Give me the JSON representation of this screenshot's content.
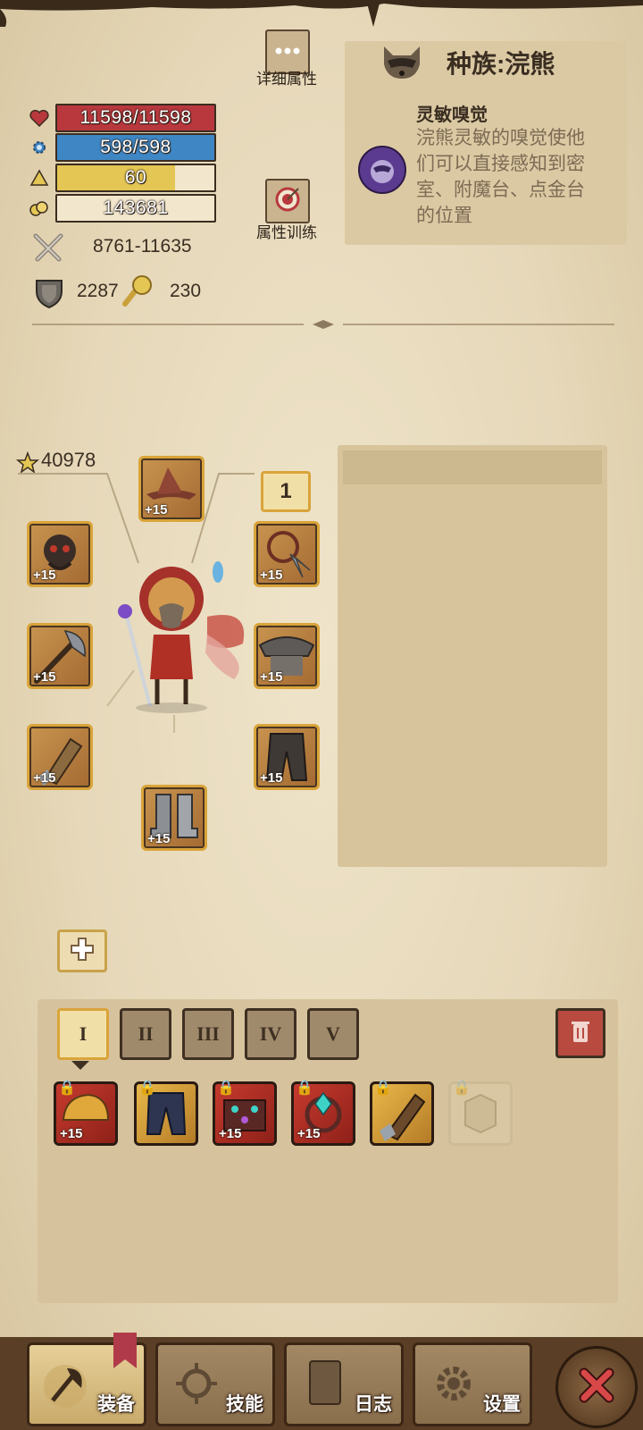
{
  "stats": {
    "hp": "11598/11598",
    "hp_fraction": 1.0,
    "mp": "598/598",
    "mp_fraction": 1.0,
    "level": "60",
    "level_fraction": 0.75,
    "gold": "143681",
    "attack": "8761-11635",
    "armor": "2287",
    "magic_resist": "230"
  },
  "buttons": {
    "detail_attr": "详细属性",
    "attr_training": "属性训练"
  },
  "race": {
    "title": "种族:浣熊",
    "trait_name": "灵敏嗅觉",
    "trait_desc": "浣熊灵敏的嗅觉使他们可以直接感知到密室、附魔台、点金台的位置"
  },
  "equipment": {
    "score": "40978",
    "set_badge": "1",
    "slots": [
      {
        "name": "hat",
        "plus": "+15"
      },
      {
        "name": "amulet",
        "plus": "+15"
      },
      {
        "name": "necklace",
        "plus": "+15"
      },
      {
        "name": "axe",
        "plus": "+15"
      },
      {
        "name": "armor",
        "plus": "+15"
      },
      {
        "name": "gauntlet",
        "plus": "+15"
      },
      {
        "name": "pants",
        "plus": "+15"
      },
      {
        "name": "boots",
        "plus": "+15"
      }
    ]
  },
  "inventory": {
    "tabs": [
      "I",
      "II",
      "III",
      "IV",
      "V"
    ],
    "active_tab": "I",
    "items": [
      {
        "rarity": "red",
        "plus": "+15"
      },
      {
        "rarity": "gold",
        "plus": ""
      },
      {
        "rarity": "red",
        "plus": "+15"
      },
      {
        "rarity": "red",
        "plus": "+15"
      },
      {
        "rarity": "gold",
        "plus": ""
      },
      {
        "rarity": "ghost",
        "plus": ""
      }
    ]
  },
  "nav": {
    "equip": "装备",
    "skills": "技能",
    "log": "日志",
    "settings": "设置"
  },
  "colors": {
    "hp": "#b8383e",
    "mp": "#3f86c4",
    "level": "#e3c653",
    "gold_frame": "#d9a43a"
  }
}
